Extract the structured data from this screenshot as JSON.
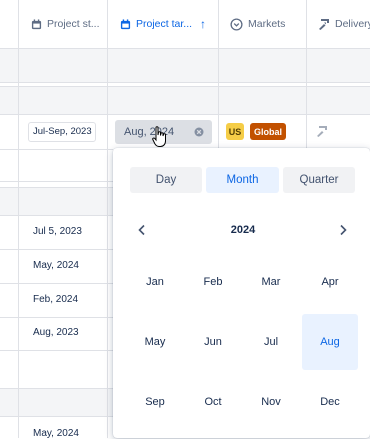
{
  "header": {
    "project_start_label": "Project st...",
    "project_target_label": "Project tar...",
    "markets_label": "Markets",
    "delivery_label": "Delivery",
    "sort_indicator": "↑",
    "icons": {
      "project_start": "calendar-icon",
      "project_target": "calendar-icon",
      "markets": "chevron-circle-icon",
      "delivery": "delivery-icon"
    }
  },
  "active_row": {
    "start_date": "Jul-Sep, 2023",
    "target_value": "Aug, 2024",
    "markets": [
      "US",
      "Global"
    ]
  },
  "rows": [
    {
      "start_date": "Jul 5, 2023"
    },
    {
      "start_date": "May, 2024"
    },
    {
      "start_date": "Feb, 2024"
    },
    {
      "start_date": "Aug, 2023"
    },
    {
      "start_date": "May, 2024"
    }
  ],
  "picker": {
    "tabs": [
      "Day",
      "Month",
      "Quarter"
    ],
    "active_tab": "Month",
    "year": "2024",
    "months": [
      "Jan",
      "Feb",
      "Mar",
      "Apr",
      "May",
      "Jun",
      "Jul",
      "Aug",
      "Sep",
      "Oct",
      "Nov",
      "Dec"
    ],
    "selected_month": "Aug"
  },
  "colors": {
    "accent": "#0c66e4",
    "selected_bg": "#e9f2ff",
    "us_badge": "#f5cd47",
    "global_badge": "#c25100",
    "grid": "#dfe1e6",
    "header_gray": "#f4f5f7"
  }
}
